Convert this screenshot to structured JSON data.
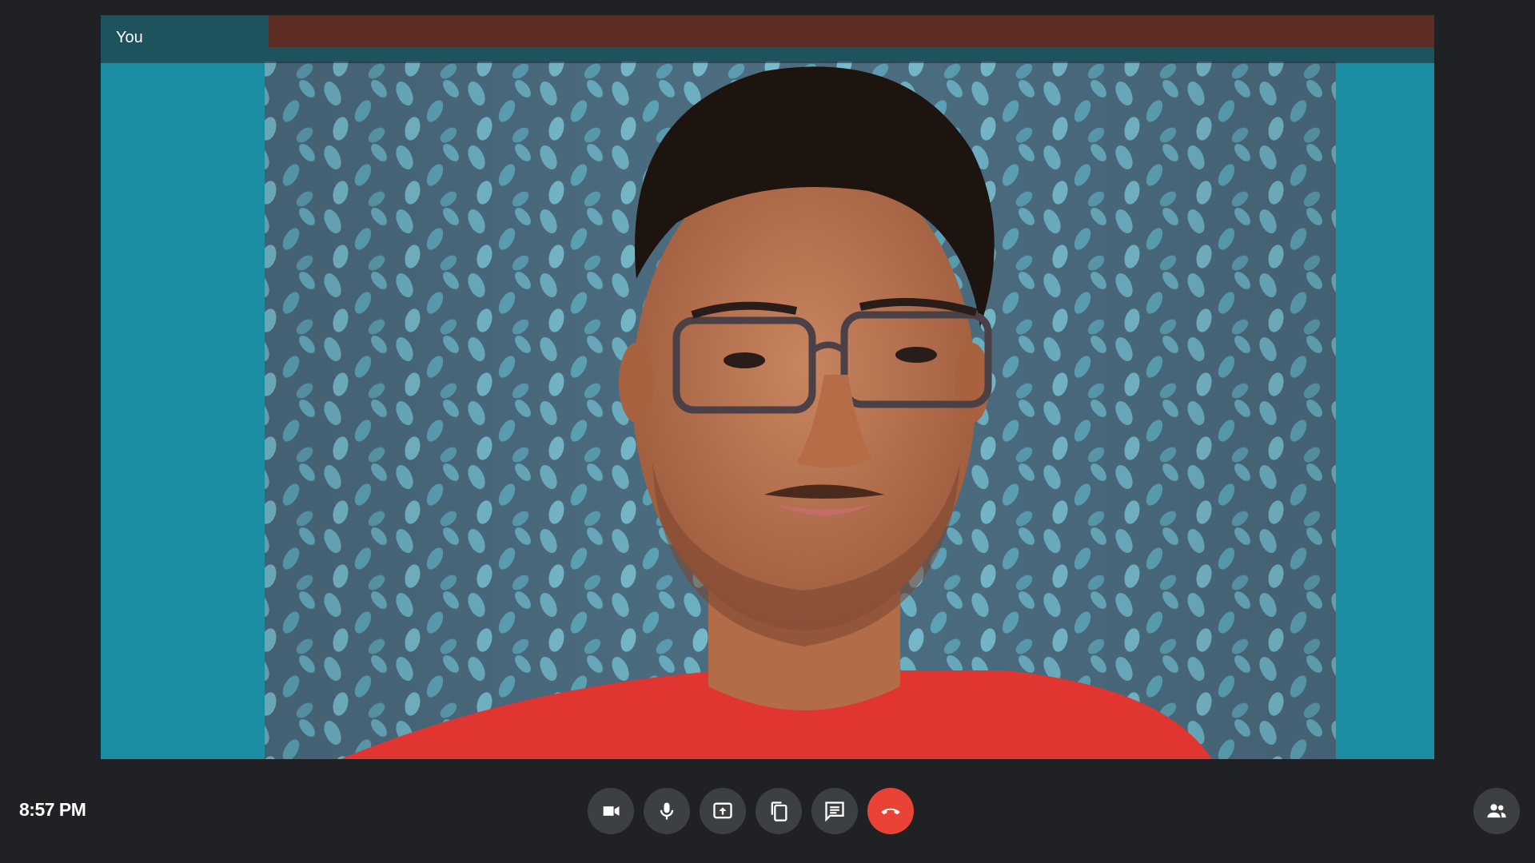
{
  "video": {
    "participant_label": "You",
    "feed_description_icon": "camera-feed"
  },
  "footer": {
    "time": "8:57 PM"
  },
  "controls": [
    {
      "name": "camera-button",
      "icon": "video-camera-icon"
    },
    {
      "name": "microphone-button",
      "icon": "microphone-icon"
    },
    {
      "name": "share-screen-button",
      "icon": "present-screen-icon"
    },
    {
      "name": "copy-link-button",
      "icon": "copy-icon"
    },
    {
      "name": "chat-button",
      "icon": "chat-icon"
    },
    {
      "name": "end-call-button",
      "icon": "hang-up-icon"
    }
  ],
  "side_controls": [
    {
      "name": "participants-button",
      "icon": "people-icon"
    }
  ],
  "colors": {
    "background": "#202124",
    "control": "#3c4043",
    "end_call": "#ea4335",
    "text": "#ffffff"
  }
}
